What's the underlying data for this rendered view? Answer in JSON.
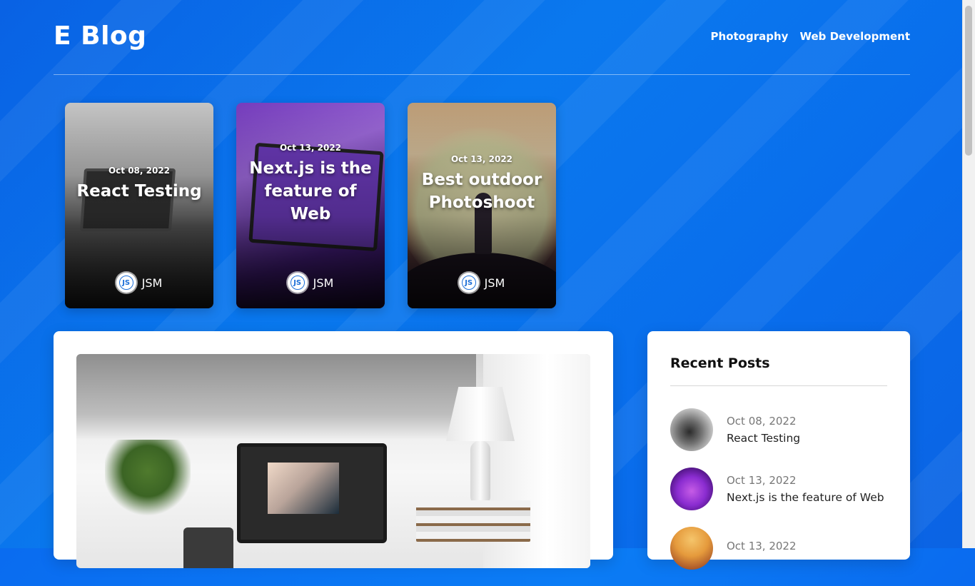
{
  "header": {
    "logo": "E Blog",
    "nav": [
      "Photography",
      "Web Development"
    ]
  },
  "featured_posts": [
    {
      "date": "Oct 08, 2022",
      "title": "React Testing",
      "author": "JSM",
      "avatar_text": "JS"
    },
    {
      "date": "Oct 13, 2022",
      "title": "Next.js is the feature of Web",
      "author": "JSM",
      "avatar_text": "JS"
    },
    {
      "date": "Oct 13, 2022",
      "title": "Best outdoor Photoshoot",
      "author": "JSM",
      "avatar_text": "JS"
    }
  ],
  "sidebar": {
    "heading": "Recent Posts",
    "items": [
      {
        "date": "Oct 08, 2022",
        "title": "React Testing"
      },
      {
        "date": "Oct 13, 2022",
        "title": "Next.js is the feature of Web"
      },
      {
        "date": "Oct 13, 2022",
        "title": ""
      }
    ]
  },
  "colors": {
    "background": "#0a6cf0",
    "card": "#ffffff",
    "text_dark": "#111111",
    "text_muted": "#777777"
  }
}
